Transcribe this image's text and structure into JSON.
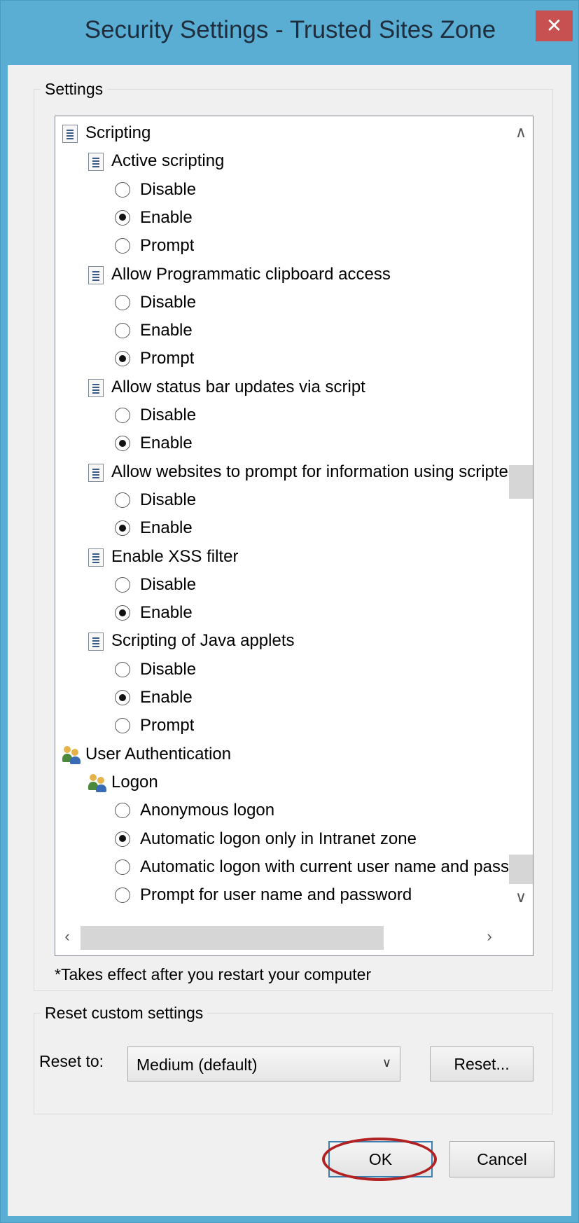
{
  "window": {
    "title": "Security Settings - Trusted Sites Zone",
    "close_glyph": "✕"
  },
  "settings": {
    "group_label": "Settings",
    "tree": [
      {
        "type": "category",
        "icon": "script-icon",
        "label": "Scripting"
      },
      {
        "type": "setting",
        "icon": "script-icon",
        "label": "Active scripting"
      },
      {
        "type": "option",
        "label": "Disable",
        "checked": false
      },
      {
        "type": "option",
        "label": "Enable",
        "checked": true
      },
      {
        "type": "option",
        "label": "Prompt",
        "checked": false
      },
      {
        "type": "setting",
        "icon": "script-icon",
        "label": "Allow Programmatic clipboard access"
      },
      {
        "type": "option",
        "label": "Disable",
        "checked": false
      },
      {
        "type": "option",
        "label": "Enable",
        "checked": false
      },
      {
        "type": "option",
        "label": "Prompt",
        "checked": true
      },
      {
        "type": "setting",
        "icon": "script-icon",
        "label": "Allow status bar updates via script"
      },
      {
        "type": "option",
        "label": "Disable",
        "checked": false
      },
      {
        "type": "option",
        "label": "Enable",
        "checked": true
      },
      {
        "type": "setting",
        "icon": "script-icon",
        "label": "Allow websites to prompt for information using scripted windo"
      },
      {
        "type": "option",
        "label": "Disable",
        "checked": false
      },
      {
        "type": "option",
        "label": "Enable",
        "checked": true
      },
      {
        "type": "setting",
        "icon": "script-icon",
        "label": "Enable XSS filter"
      },
      {
        "type": "option",
        "label": "Disable",
        "checked": false
      },
      {
        "type": "option",
        "label": "Enable",
        "checked": true
      },
      {
        "type": "setting",
        "icon": "script-icon",
        "label": "Scripting of Java applets"
      },
      {
        "type": "option",
        "label": "Disable",
        "checked": false
      },
      {
        "type": "option",
        "label": "Enable",
        "checked": true
      },
      {
        "type": "option",
        "label": "Prompt",
        "checked": false
      },
      {
        "type": "category",
        "icon": "users-icon",
        "label": "User Authentication"
      },
      {
        "type": "setting",
        "icon": "users-icon",
        "label": "Logon"
      },
      {
        "type": "option",
        "label": "Anonymous logon",
        "checked": false
      },
      {
        "type": "option",
        "label": "Automatic logon only in Intranet zone",
        "checked": true
      },
      {
        "type": "option",
        "label": "Automatic logon with current user name and password",
        "checked": false
      },
      {
        "type": "option",
        "label": "Prompt for user name and password",
        "checked": false
      }
    ],
    "restart_note": "*Takes effect after you restart your computer"
  },
  "reset": {
    "group_label": "Reset custom settings",
    "reset_to_label": "Reset to:",
    "level_value": "Medium (default)",
    "reset_button": "Reset..."
  },
  "buttons": {
    "ok": "OK",
    "cancel": "Cancel"
  },
  "colors": {
    "titlebar": "#5aaed4",
    "close": "#c75050",
    "annotation_ring": "#b22222"
  }
}
